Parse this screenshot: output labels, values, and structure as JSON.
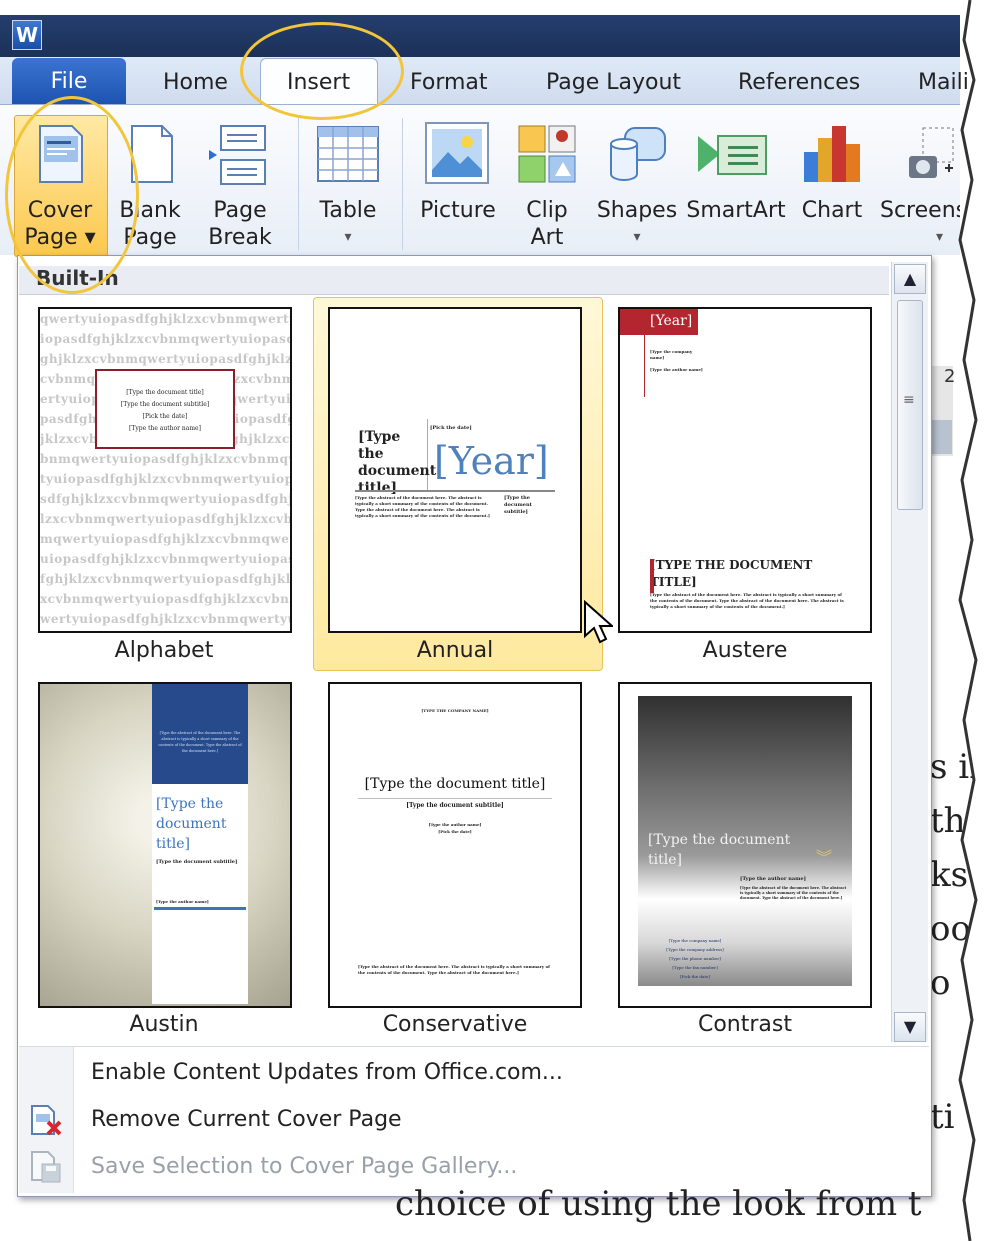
{
  "app": {
    "logo_letter": "W"
  },
  "tabs": [
    "File",
    "Home",
    "Insert",
    "Format",
    "Page Layout",
    "References",
    "Maili"
  ],
  "ribbon": {
    "cover_page": [
      "Cover",
      "Page ▾"
    ],
    "blank_page": [
      "Blank",
      "Page"
    ],
    "page_break": [
      "Page",
      "Break"
    ],
    "table": [
      "Table",
      "▾"
    ],
    "picture": [
      "Picture"
    ],
    "clip_art": [
      "Clip",
      "Art"
    ],
    "shapes": [
      "Shapes",
      "▾"
    ],
    "smartart": [
      "SmartArt"
    ],
    "chart": [
      "Chart"
    ],
    "screenshot": [
      "Screens",
      "▾"
    ]
  },
  "gallery": {
    "section_label": "Built-In",
    "items": [
      {
        "name": "Alphabet"
      },
      {
        "name": "Annual"
      },
      {
        "name": "Austere"
      },
      {
        "name": "Austin"
      },
      {
        "name": "Conservative"
      },
      {
        "name": "Contrast"
      }
    ],
    "alphabet_text": "qwertyuiopasdfghjklzxcvbnm",
    "alphabet_box": [
      "[Type the document title]",
      "[Type the document subtitle]",
      "[Pick the date]",
      "[Type the author name]"
    ],
    "annual": {
      "date": "[Pick the date]",
      "title": "[Type the document title]",
      "year": "[Year]",
      "subtitle": "[Type the document subtitle]",
      "abstract": "[Type the abstract of the document here. The abstract is typically a short summary of the contents of the document. Type the abstract of the document here. The abstract is typically a short summary of the contents of the document.]"
    },
    "austere": {
      "year": "[Year]",
      "company": "[Type the company name]",
      "author": "[Type the author name]",
      "title": "[TYPE THE DOCUMENT TITLE]",
      "abstract": "[Type the abstract of the document here. The abstract is typically a short summary of the contents of the document. Type the abstract of the document here. The abstract is typically a short summary of the contents of the document.]"
    },
    "austin": {
      "abstract": "[Type the abstract of the document here. The abstract is typically a short summary of the contents of the document. Type the abstract of the document here.]",
      "title": "[Type the document title]",
      "subtitle": "[Type the document subtitle]",
      "author": "[Type the author name]"
    },
    "conservative": {
      "company": "[TYPE THE COMPANY NAME]",
      "title": "[Type the document title]",
      "subtitle": "[Type the document subtitle]",
      "author": "[Type the author name]",
      "date": "[Pick the date]",
      "abstract": "[Type the abstract of the document here. The abstract is typically a short summary of the contents of the document. Type the abstract of the document here.]"
    },
    "contrast": {
      "title": "[Type the document title]",
      "author": "[Type the author name]",
      "abstract": "[Type the abstract of the document here. The abstract is typically a short summary of the contents of the document. Type the abstract of the document here.]",
      "lines": [
        "[Type the company name]",
        "[Type the company address]",
        "[Type the phone number]",
        "[Type the fax number]",
        "[Pick the date]"
      ]
    }
  },
  "menu": {
    "enable_updates": "Enable Content Updates from Office.com...",
    "remove_cover": "Remove Current Cover Page",
    "save_selection": "Save Selection to Cover Page Gallery..."
  },
  "background_doc": {
    "fragments": [
      "s in",
      "thes",
      "ks",
      "oo",
      "o",
      "ti"
    ],
    "bottom_line": "choice of using the look from t",
    "ruler_number": "2"
  },
  "colors": {
    "highlight": "#f3c53b",
    "file_tab": "#2a62c2",
    "austin_blue": "#264a8c",
    "austere_red": "#b3262f"
  }
}
